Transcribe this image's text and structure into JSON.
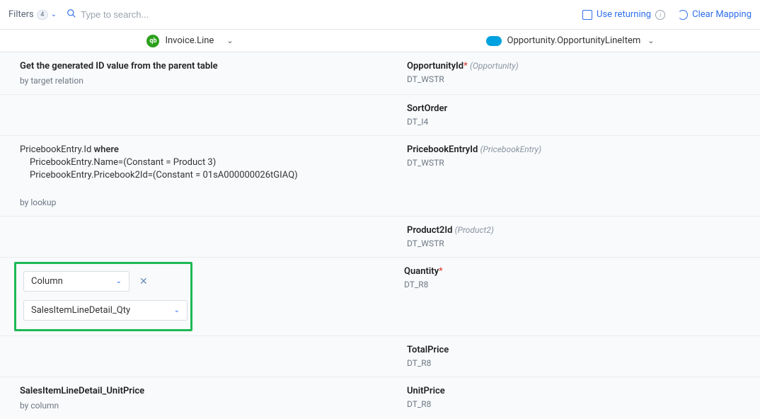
{
  "toolbar": {
    "filters_label": "Filters",
    "filters_count": "4",
    "search_placeholder": "Type to search...",
    "use_returning_label": "Use returning",
    "clear_mapping_label": "Clear Mapping"
  },
  "headers": {
    "source_label": "Invoice.Line",
    "target_label": "Opportunity.OpportunityLineItem"
  },
  "rows": [
    {
      "left_title": "Get the generated ID value from the parent table",
      "left_by": "by target relation",
      "right_name": "OpportunityId",
      "right_required": "*",
      "right_ref": "(Opportunity)",
      "right_type": "DT_WSTR"
    },
    {
      "left_title": "",
      "left_by": "",
      "right_name": "SortOrder",
      "right_required": "",
      "right_ref": "",
      "right_type": "DT_I4"
    },
    {
      "lookup_src": "PricebookEntry.Id",
      "lookup_where": "where",
      "lookup_cond1": "PricebookEntry.Name=(Constant = Product 3)",
      "lookup_cond2": "PricebookEntry.Pricebook2Id=(Constant = 01sA000000026tGIAQ)",
      "left_by": "by lookup",
      "right_name": "PricebookEntryId",
      "right_required": "",
      "right_ref": "(PricebookEntry)",
      "right_type": "DT_WSTR"
    },
    {
      "left_title": "",
      "left_by": "",
      "right_name": "Product2Id",
      "right_required": "",
      "right_ref": "(Product2)",
      "right_type": "DT_WSTR"
    },
    {
      "highlight": true,
      "select_type": "Column",
      "select_column": "SalesItemLineDetail_Qty",
      "right_name": "Quantity",
      "right_required": "*",
      "right_ref": "",
      "right_type": "DT_R8"
    },
    {
      "left_title": "",
      "left_by": "",
      "right_name": "TotalPrice",
      "right_required": "",
      "right_ref": "",
      "right_type": "DT_R8"
    },
    {
      "left_title": "SalesItemLineDetail_UnitPrice",
      "left_by": "by column",
      "right_name": "UnitPrice",
      "right_required": "",
      "right_ref": "",
      "right_type": "DT_R8"
    }
  ]
}
